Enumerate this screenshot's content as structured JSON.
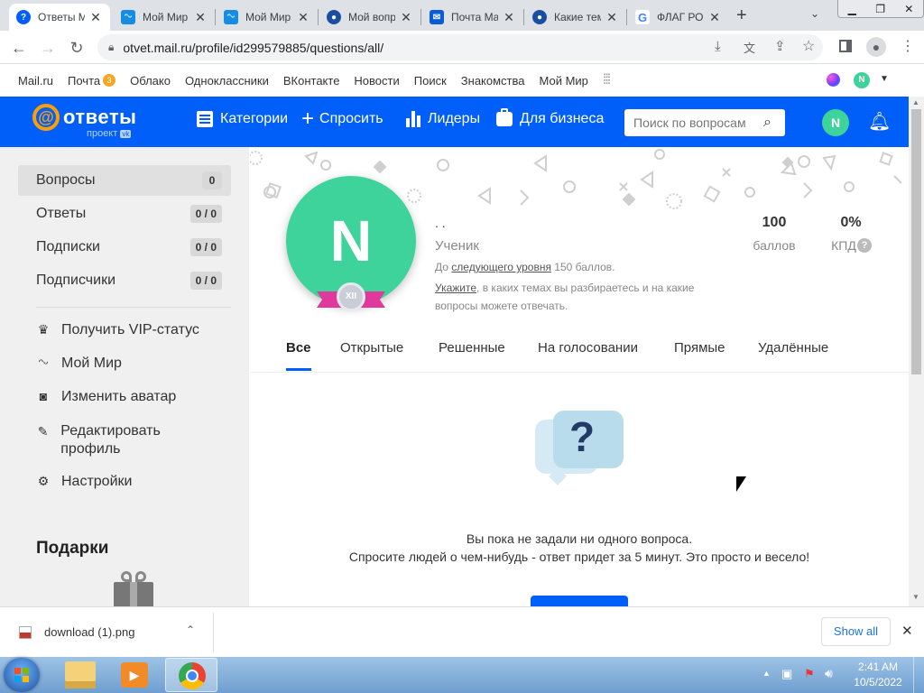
{
  "browser": {
    "tabs": [
      {
        "title": "Ответы Mail.ru",
        "active": true
      },
      {
        "title": "Мой Мир"
      },
      {
        "title": "Мой Мир"
      },
      {
        "title": "Мой вопрос"
      },
      {
        "title": "Почта Mail.ru"
      },
      {
        "title": "Какие темы"
      },
      {
        "title": "ФЛАГ РОССИИ"
      }
    ],
    "url": "otvet.mail.ru/profile/id299579885/questions/all/"
  },
  "portal": {
    "links": [
      "Mail.ru",
      "Почта",
      "Облако",
      "Одноклассники",
      "ВКонтакте",
      "Новости",
      "Поиск",
      "Знакомства",
      "Мой Мир"
    ],
    "mail_badge": "3",
    "avatar_letter": "N"
  },
  "header": {
    "logo_main": "ответы",
    "logo_sub": "проект",
    "logo_vk": "vk",
    "nav": [
      "Категории",
      "Спросить",
      "Лидеры",
      "Для бизнеса"
    ],
    "search_placeholder": "Поиск по вопросам",
    "avatar_letter": "N"
  },
  "sidebar": {
    "menu": [
      {
        "label": "Вопросы",
        "count": "0"
      },
      {
        "label": "Ответы",
        "count": "0 / 0"
      },
      {
        "label": "Подписки",
        "count": "0 / 0"
      },
      {
        "label": "Подписчики",
        "count": "0 / 0"
      }
    ],
    "actions": [
      "Получить VIP-статус",
      "Мой Мир",
      "Изменить аватар",
      "Редактировать профиль",
      "Настройки"
    ],
    "gifts_title": "Подарки"
  },
  "profile": {
    "avatar_letter": "N",
    "level_badge": "XII",
    "name": ". .",
    "rank": "Ученик",
    "progress_prefix": "До",
    "progress_link": "следующего уровня",
    "progress_suffix": "150 баллов.",
    "hint_link": "Укажите",
    "hint_line1": ", в каких темах вы разбираетесь и на какие",
    "hint_line2": "вопросы можете отвечать.",
    "points_value": "100",
    "points_label": "баллов",
    "kpd_value": "0%",
    "kpd_label": "КПД",
    "help": "?"
  },
  "tabs": [
    "Все",
    "Открытые",
    "Решенные",
    "На голосовании",
    "Прямые",
    "Удалённые"
  ],
  "empty": {
    "line1": "Вы пока не задали ни одного вопроса.",
    "line2": "Спросите людей о чем-нибудь - ответ придет за 5 минут. Это просто и весело!",
    "icon_glyph": "?"
  },
  "downloads": {
    "file": "download (1).png",
    "show_all": "Show all"
  },
  "taskbar": {
    "time": "2:41 AM",
    "date": "10/5/2022"
  },
  "colors": {
    "brand_blue": "#005ff9",
    "avatar_green": "#3dd39a",
    "level_pink": "#e0399b"
  }
}
